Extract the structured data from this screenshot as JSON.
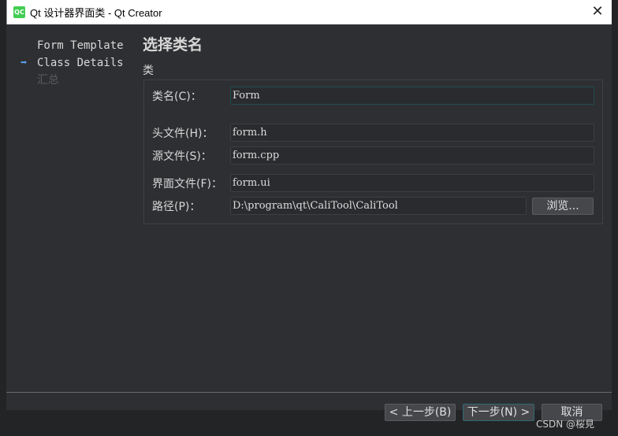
{
  "window": {
    "title": "Qt 设计器界面类 - Qt Creator",
    "logo": "QC",
    "close": "✕"
  },
  "sidebar": {
    "items": [
      {
        "label": "Form Template"
      },
      {
        "label": "Class Details",
        "current": true
      },
      {
        "label": "汇总"
      }
    ],
    "current_icon": "arrow-right-icon"
  },
  "page": {
    "title": "选择类名",
    "group": "类"
  },
  "fields": {
    "class_name": {
      "label": "类名(C)：",
      "value": "Form"
    },
    "header": {
      "label": "头文件(H)：",
      "value": "form.h"
    },
    "source": {
      "label": "源文件(S)：",
      "value": "form.cpp"
    },
    "form": {
      "label": "界面文件(F)：",
      "value": "form.ui"
    },
    "path": {
      "label": "路径(P)：",
      "value": "D:\\program\\qt\\CaliTool\\CaliTool"
    }
  },
  "browse_label": "浏览...",
  "footer": {
    "back": "< 上一步(B)",
    "next": "下一步(N) >",
    "cancel": "取消"
  },
  "watermark": "CSDN @桜見",
  "colors": {
    "accent": "#5ba3ef",
    "focus": "#1f4b54"
  }
}
